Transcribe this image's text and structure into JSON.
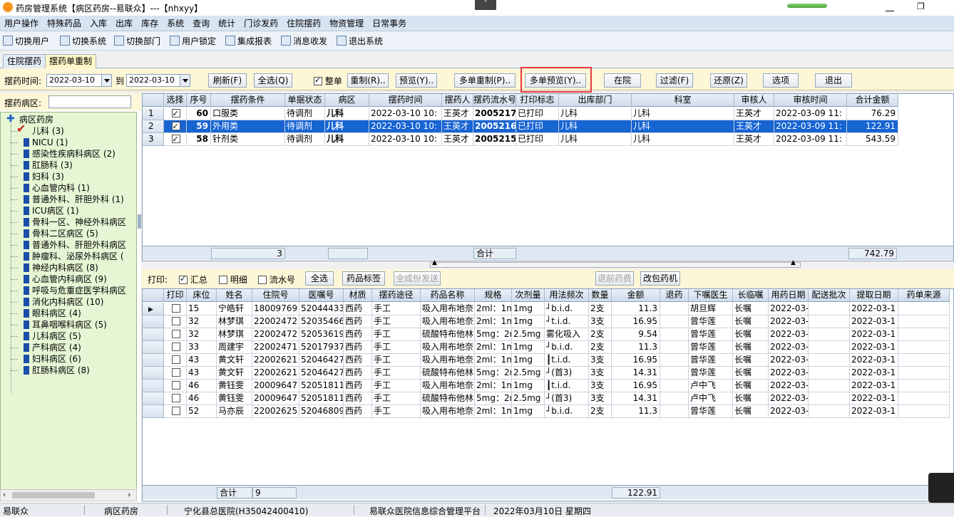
{
  "window": {
    "title": "药房管理系统【病区药房--易联众】---【nhxyy】",
    "collapse_label": "˅",
    "restore_label": "❐"
  },
  "menu": [
    "用户操作",
    "特殊药品",
    "入库",
    "出库",
    "库存",
    "系统",
    "查询",
    "统计",
    "门诊发药",
    "住院摆药",
    "物资管理",
    "日常事务"
  ],
  "toolbar": [
    {
      "label": "切换用户",
      "icon": "switch-user-icon"
    },
    {
      "label": "切换系统",
      "icon": "switch-system-icon"
    },
    {
      "label": "切换部门",
      "icon": "switch-department-icon"
    },
    {
      "label": "用户锁定",
      "icon": "user-lock-icon"
    },
    {
      "label": "集成报表",
      "icon": "report-icon"
    },
    {
      "label": "消息收发",
      "icon": "message-icon"
    },
    {
      "label": "退出系统",
      "icon": "exit-icon"
    }
  ],
  "tabs": [
    "住院摆药",
    "摆药单重制"
  ],
  "filter": {
    "time_label": "摆药时间:",
    "date_from": "2022-03-10",
    "to_label": "到",
    "date_to": "2022-03-10",
    "buttons": [
      "刷新(F)",
      "全选(Q)",
      "重制(R)..",
      "预览(Y)..",
      "多单重制(P)..",
      "多单预览(Y)..",
      "在院",
      "过滤(F)",
      "还原(Z)",
      "选项",
      "退出"
    ],
    "whole_label": "整单",
    "whole_checked": true
  },
  "ward_search_label": "摆药病区:",
  "tree": {
    "root": "病区药房",
    "selected_index": 0,
    "items": [
      "儿科 (3)",
      "NICU (1)",
      "感染性疾病科病区 (2)",
      "肛肠科 (3)",
      "妇科 (3)",
      "心血管内科 (1)",
      "普通外科、肝胆外科 (1)",
      "ICU病区 (1)",
      "骨科一区、神经外科病区",
      "骨科二区病区 (5)",
      "普通外科、肝胆外科病区",
      "肿瘤科、泌尿外科病区 (",
      "神经内科病区 (8)",
      "心血管内科病区 (9)",
      "呼吸与危重症医学科病区",
      "消化内科病区 (10)",
      "眼科病区 (4)",
      "耳鼻咽喉科病区 (5)",
      "儿科病区 (5)",
      "产科病区 (4)",
      "妇科病区 (6)",
      "肛肠科病区 (8)"
    ]
  },
  "top_grid": {
    "headers": [
      "选择",
      "序号",
      "摆药条件",
      "单据状态",
      "病区",
      "摆药时间",
      "摆药人",
      "摆药流水号",
      "打印标志",
      "出库部门",
      "科室",
      "审核人",
      "审核时间",
      "合计金额"
    ],
    "rows": [
      {
        "rh": "1",
        "checked": true,
        "seq": "60",
        "cond": "口服类",
        "status": "待调剂",
        "ward": "儿科",
        "time": "2022-03-10 10:",
        "person": "王英才",
        "serial": "2005217",
        "print": "已打印",
        "dept": "儿科",
        "room": "儿科",
        "auditor": "王英才",
        "audit_time": "2022-03-09 11:",
        "amount": "76.29"
      },
      {
        "rh": "2",
        "checked": true,
        "seq": "59",
        "cond": "外用类",
        "status": "待调剂",
        "ward": "儿科",
        "time": "2022-03-10 10:",
        "person": "王英才",
        "serial": "2005216",
        "print": "已打印",
        "dept": "儿科",
        "room": "儿科",
        "auditor": "王英才",
        "audit_time": "2022-03-09 11:",
        "amount": "122.91"
      },
      {
        "rh": "3",
        "checked": true,
        "seq": "58",
        "cond": "针剂类",
        "status": "待调剂",
        "ward": "儿科",
        "time": "2022-03-10 10:",
        "person": "王英才",
        "serial": "2005215",
        "print": "已打印",
        "dept": "儿科",
        "room": "儿科",
        "auditor": "王英才",
        "audit_time": "2022-03-09 11:",
        "amount": "543.59"
      }
    ],
    "selected_row": 1,
    "footer": {
      "count": "3",
      "total_label": "合计",
      "total": "742.79"
    }
  },
  "print_bar": {
    "label": "打印:",
    "options": [
      {
        "label": "汇总",
        "checked": true
      },
      {
        "label": "明细",
        "checked": false
      },
      {
        "label": "流水号",
        "checked": false
      }
    ],
    "buttons": [
      "全选",
      "药品标签",
      "全成份发送",
      "退前药费",
      "改包药机"
    ]
  },
  "bottom_grid": {
    "headers": [
      "打印",
      "床位",
      "姓名",
      "住院号",
      "医嘱号",
      "材质",
      "摆药途径",
      "药品名称",
      "规格",
      "次剂量",
      "用法频次",
      "数量",
      "金额",
      "退药",
      "下嘱医生",
      "长临嘱",
      "用药日期",
      "配送批次",
      "提取日期",
      "药单来源"
    ],
    "rows": [
      {
        "bed": "15",
        "name": "宁皓轩",
        "inpatient": "18009769",
        "order": "52044433",
        "mat": "西药",
        "route": "手工",
        "drug": "吸入用布地奈",
        "spec": "2ml：1m",
        "dose": "1mg",
        "freq": "┘b.i.d.",
        "qty": "2支",
        "amt": "11.3",
        "doctor": "胡旦辉",
        "type": "长嘱",
        "date": "2022-03-",
        "pick": "2022-03-1"
      },
      {
        "bed": "32",
        "name": "林梦琪",
        "inpatient": "22002472",
        "order": "52035466",
        "mat": "西药",
        "route": "手工",
        "drug": "吸入用布地奈",
        "spec": "2ml：1m",
        "dose": "1mg",
        "freq": "┘t.i.d.",
        "qty": "3支",
        "amt": "16.95",
        "doctor": "曾华莲",
        "type": "长嘱",
        "date": "2022-03-",
        "pick": "2022-03-1"
      },
      {
        "bed": "32",
        "name": "林梦琪",
        "inpatient": "22002472",
        "order": "52053619",
        "mat": "西药",
        "route": "手工",
        "drug": "硫酸特布他林",
        "spec": "5mg：2m",
        "dose": "2.5mg",
        "freq": "雾化吸入",
        "qty": "2支",
        "amt": "9.54",
        "doctor": "曾华莲",
        "type": "长嘱",
        "date": "2022-03-",
        "pick": "2022-03-1"
      },
      {
        "bed": "33",
        "name": "周建宇",
        "inpatient": "22002471",
        "order": "52017937",
        "mat": "西药",
        "route": "手工",
        "drug": "吸入用布地奈",
        "spec": "2ml：1m",
        "dose": "1mg",
        "freq": "┘b.i.d.",
        "qty": "2支",
        "amt": "11.3",
        "doctor": "曾华莲",
        "type": "长嘱",
        "date": "2022-03-",
        "pick": "2022-03-1"
      },
      {
        "bed": "43",
        "name": "黄文轩",
        "inpatient": "22002621",
        "order": "52046427",
        "mat": "西药",
        "route": "手工",
        "drug": "吸入用布地奈",
        "spec": "2ml：1m",
        "dose": "1mg",
        "freq": "┃t.i.d.",
        "qty": "3支",
        "amt": "16.95",
        "doctor": "曾华莲",
        "type": "长嘱",
        "date": "2022-03-",
        "pick": "2022-03-1"
      },
      {
        "bed": "43",
        "name": "黄文轩",
        "inpatient": "22002621",
        "order": "52046427",
        "mat": "西药",
        "route": "手工",
        "drug": "硫酸特布他林",
        "spec": "5mg：2m",
        "dose": "2.5mg",
        "freq": "┘(首3)",
        "qty": "3支",
        "amt": "14.31",
        "doctor": "曾华莲",
        "type": "长嘱",
        "date": "2022-03-",
        "pick": "2022-03-1"
      },
      {
        "bed": "46",
        "name": "黄钰雯",
        "inpatient": "20009647",
        "order": "52051811",
        "mat": "西药",
        "route": "手工",
        "drug": "吸入用布地奈",
        "spec": "2ml：1m",
        "dose": "1mg",
        "freq": "┃t.i.d.",
        "qty": "3支",
        "amt": "16.95",
        "doctor": "卢中飞",
        "type": "长嘱",
        "date": "2022-03-",
        "pick": "2022-03-1"
      },
      {
        "bed": "46",
        "name": "黄钰雯",
        "inpatient": "20009647",
        "order": "52051811",
        "mat": "西药",
        "route": "手工",
        "drug": "硫酸特布他林",
        "spec": "5mg：2m",
        "dose": "2.5mg",
        "freq": "┘(首3)",
        "qty": "3支",
        "amt": "14.31",
        "doctor": "卢中飞",
        "type": "长嘱",
        "date": "2022-03-",
        "pick": "2022-03-1"
      },
      {
        "bed": "52",
        "name": "马亦辰",
        "inpatient": "22002625",
        "order": "52046809",
        "mat": "西药",
        "route": "手工",
        "drug": "吸入用布地奈",
        "spec": "2ml：1m",
        "dose": "1mg",
        "freq": "┘b.i.d.",
        "qty": "2支",
        "amt": "11.3",
        "doctor": "曾华莲",
        "type": "长嘱",
        "date": "2022-03-",
        "pick": "2022-03-1"
      }
    ],
    "footer": {
      "total_label": "合计",
      "count": "9",
      "total": "122.91"
    }
  },
  "status": [
    "易联众",
    "病区药房",
    "宁化县总医院(H35042400410)",
    "易联众医院信息综合管理平台",
    "2022年03月10日 星期四"
  ],
  "colors": {
    "selected": "#1764d3",
    "highlight_box": "#e53a3a",
    "tree_bg": "#e6f6d5",
    "filter_bg": "#fdf6d7"
  }
}
